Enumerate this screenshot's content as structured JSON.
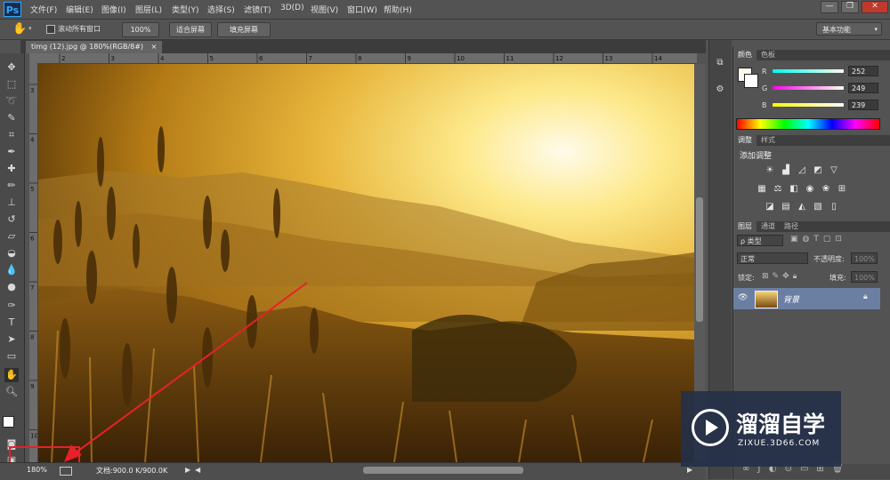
{
  "app": {
    "logo": "Ps"
  },
  "menu": [
    "文件(F)",
    "编辑(E)",
    "图像(I)",
    "图层(L)",
    "类型(Y)",
    "选择(S)",
    "滤镜(T)",
    "3D(D)",
    "视图(V)",
    "窗口(W)",
    "帮助(H)"
  ],
  "window_controls": {
    "minimize": "—",
    "restore": "❐",
    "close": "✕"
  },
  "options": {
    "scroll_all_windows": "滚动所有窗口",
    "zoom_100": "100%",
    "fit_screen": "适合屏幕",
    "fill_screen": "填充屏幕",
    "workspace": "基本功能"
  },
  "document": {
    "tab_title": "timg (12).jpg @ 180%(RGB/8#)",
    "tab_close": "×"
  },
  "ruler": {
    "top_labels": [
      "2",
      "3",
      "4",
      "5",
      "6",
      "7",
      "8",
      "9",
      "10",
      "11",
      "12",
      "13",
      "14",
      "15",
      "16",
      "17",
      "18",
      "19"
    ],
    "left_labels": [
      "3",
      "4",
      "5",
      "6",
      "7",
      "8",
      "9",
      "10"
    ]
  },
  "status": {
    "zoom": "180%",
    "doc_info": "文档:900.0 K/900.0K"
  },
  "color_panel": {
    "tabs": [
      "颜色",
      "色板"
    ],
    "channels": [
      {
        "label": "R",
        "value": "252"
      },
      {
        "label": "G",
        "value": "249"
      },
      {
        "label": "B",
        "value": "239"
      }
    ]
  },
  "adjust_panel": {
    "tabs": [
      "调整",
      "样式"
    ],
    "title": "添加调整"
  },
  "layers_panel": {
    "tabs": [
      "图层",
      "通道",
      "路径"
    ],
    "filter_kind": "ρ 类型",
    "blend_mode": "正常",
    "opacity_label": "不透明度:",
    "opacity_value": "100%",
    "lock_label": "锁定:",
    "fill_label": "填充:",
    "fill_value": "100%",
    "layer_name": "背景"
  },
  "watermark": {
    "title": "溜溜自学",
    "url": "ZIXUE.3D66.COM"
  },
  "colors": {
    "accent_red": "#e8202a",
    "layer_selected": "#6b7fa3"
  }
}
